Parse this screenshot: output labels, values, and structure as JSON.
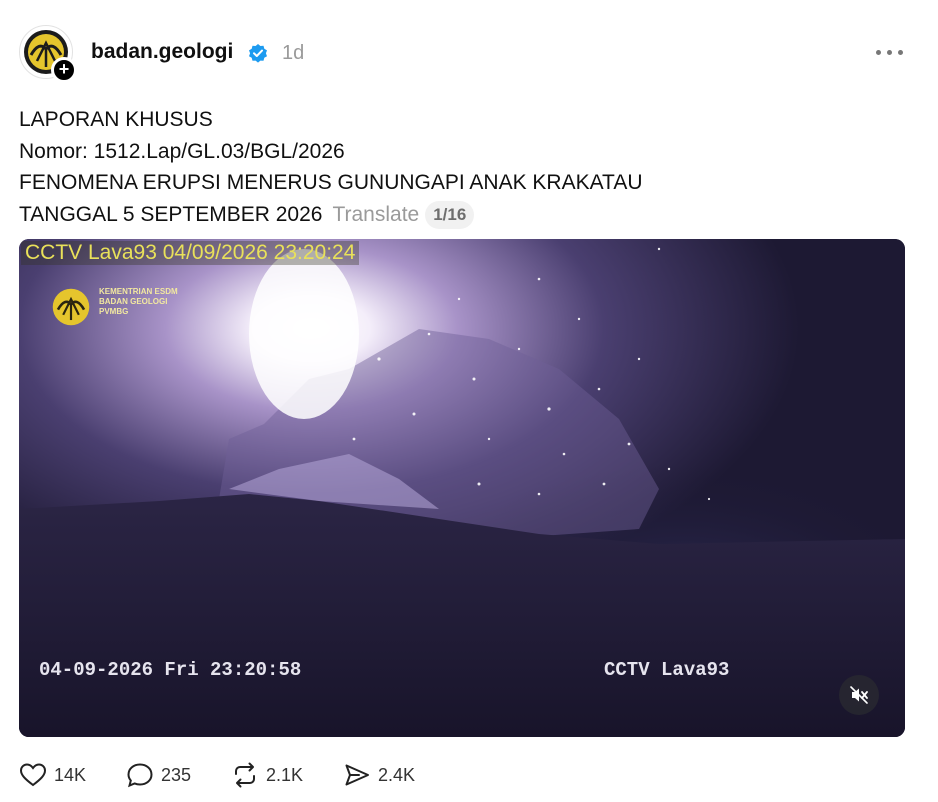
{
  "header": {
    "username": "badan.geologi",
    "timestamp": "1d",
    "verified_icon": "verified-badge-icon",
    "follow_icon": "plus-icon",
    "more_icon": "more-options-icon"
  },
  "post": {
    "lines": [
      "LAPORAN KHUSUS",
      "Nomor: 1512.Lap/GL.03/BGL/2026",
      "FENOMENA ERUPSI MENERUS GUNUNGAPI ANAK KRAKATAU",
      "TANGGAL 5 SEPTEMBER 2026"
    ],
    "translate_label": "Translate",
    "media_count": "1/16"
  },
  "video": {
    "osd_top": "CCTV Lava93 04/09/2026 23:20:24",
    "watermark_lines": [
      "KEMENTRIAN ESDM",
      "BADAN GEOLOGI",
      "PVMBG"
    ],
    "osd_bottom_left": "04-09-2026 Fri 23:20:58",
    "osd_bottom_right": "CCTV Lava93",
    "mute_icon": "speaker-muted-icon"
  },
  "actions": {
    "likes": "14K",
    "comments": "235",
    "reposts": "2.1K",
    "shares": "2.4K"
  },
  "colors": {
    "osd_yellow": "#e9e15a",
    "verified_blue": "#1d9bf0",
    "muted_gray": "#9a9a9a"
  }
}
